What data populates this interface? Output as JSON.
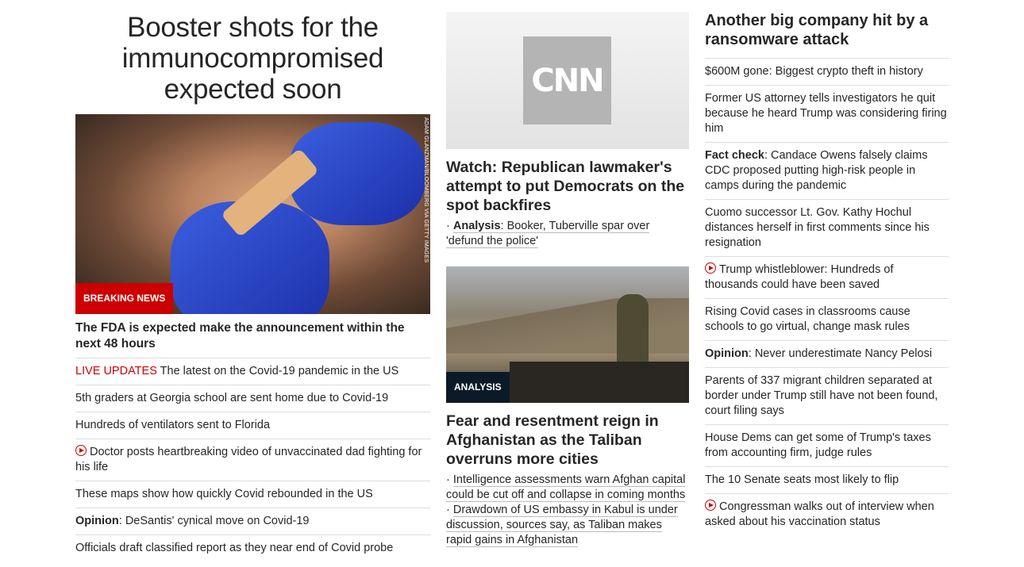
{
  "col1": {
    "headline": "Booster shots for the immunocompromised expected soon",
    "photo_credit": "ADAM GLANZMAN/BLOOMBERG VIA GETTY IMAGES",
    "badge": "BREAKING NEWS",
    "subhead": "The FDA is expected make the announcement within the next 48 hours",
    "live_label": "LIVE UPDATES",
    "live_text": "The latest on the Covid-19 pandemic in the US",
    "items": [
      "5th graders at Georgia school are sent home due to Covid-19",
      "Hundreds of ventilators sent to Florida"
    ],
    "video_item": "Doctor posts heartbreaking video of unvaccinated dad fighting for his life",
    "item_maps": "These maps show how quickly Covid rebounded in the US",
    "opinion_label": "Opinion",
    "opinion_text": ": DeSantis' cynical move on Covid-19",
    "item_last": "Officials draft classified report as they near end of Covid probe"
  },
  "col2": {
    "logo": "CNN",
    "story1": "Watch: Republican lawmaker's attempt to put Democrats on the spot backfires",
    "story1_label": "Analysis",
    "story1_bullet": ": Booker, Tuberville spar over 'defund the police'",
    "badge": "ANALYSIS",
    "story2": "Fear and resentment reign in Afghanistan as the Taliban overruns more cities",
    "bullets": [
      "Intelligence assessments warn Afghan capital could be cut off and collapse in coming months",
      "Drawdown of US embassy in Kabul is under discussion, sources say, as Taliban makes rapid gains in Afghanistan"
    ]
  },
  "col3": {
    "headline": "Another big company hit by a ransomware attack",
    "i1": "$600M gone: Biggest crypto theft in history",
    "i2": "Former US attorney tells investigators he quit because he heard Trump was considering firing him",
    "i3_label": "Fact check",
    "i3": ": Candace Owens falsely claims CDC proposed putting high-risk people in camps during the pandemic",
    "i4": "Cuomo successor Lt. Gov. Kathy Hochul distances herself in first comments since his resignation",
    "i5": "Trump whistleblower: Hundreds of thousands could have been saved",
    "i6": "Rising Covid cases in classrooms cause schools to go virtual, change mask rules",
    "i7_label": "Opinion",
    "i7": ": Never underestimate Nancy Pelosi",
    "i8": "Parents of 337 migrant children separated at border under Trump still have not been found, court filing says",
    "i9": "House Dems can get some of Trump's taxes from accounting firm, judge rules",
    "i10": "The 10 Senate seats most likely to flip",
    "i11": "Congressman walks out of interview when asked about his vaccination status"
  }
}
